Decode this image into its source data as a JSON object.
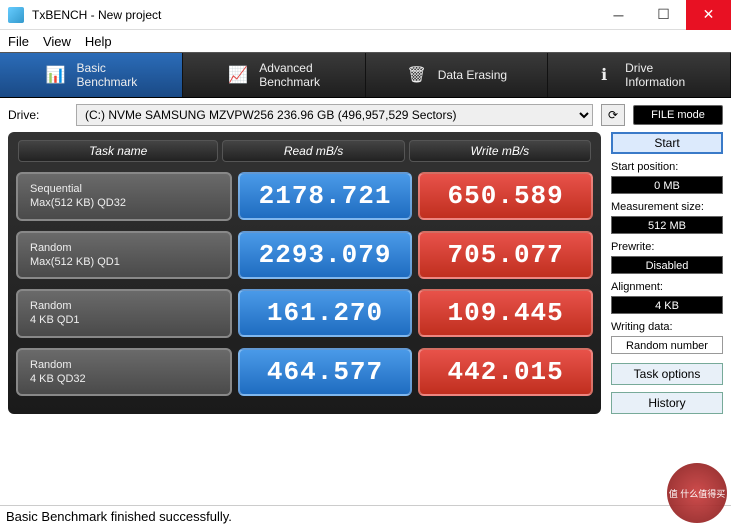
{
  "window": {
    "title": "TxBENCH - New project"
  },
  "menu": [
    "File",
    "View",
    "Help"
  ],
  "tabs": [
    {
      "label": "Basic\nBenchmark",
      "icon": "📊"
    },
    {
      "label": "Advanced\nBenchmark",
      "icon": "📈"
    },
    {
      "label": "Data Erasing",
      "icon": "🗑"
    },
    {
      "label": "Drive\nInformation",
      "icon": "ℹ"
    }
  ],
  "drive": {
    "label": "Drive:",
    "selected": "(C:) NVMe SAMSUNG MZVPW256  236.96 GB (496,957,529 Sectors)",
    "filemode": "FILE mode"
  },
  "headers": {
    "task": "Task name",
    "read": "Read mB/s",
    "write": "Write mB/s"
  },
  "rows": [
    {
      "name1": "Sequential",
      "name2": "Max(512 KB) QD32",
      "read": "2178.721",
      "write": "650.589"
    },
    {
      "name1": "Random",
      "name2": "Max(512 KB) QD1",
      "read": "2293.079",
      "write": "705.077"
    },
    {
      "name1": "Random",
      "name2": "4 KB QD1",
      "read": "161.270",
      "write": "109.445"
    },
    {
      "name1": "Random",
      "name2": "4 KB QD32",
      "read": "464.577",
      "write": "442.015"
    }
  ],
  "side": {
    "start": "Start",
    "startpos_label": "Start position:",
    "startpos": "0 MB",
    "msize_label": "Measurement size:",
    "msize": "512 MB",
    "prewrite_label": "Prewrite:",
    "prewrite": "Disabled",
    "align_label": "Alignment:",
    "align": "4 KB",
    "wdata_label": "Writing data:",
    "wdata": "Random number",
    "taskopt": "Task options",
    "history": "History"
  },
  "status": "Basic Benchmark finished successfully.",
  "watermark": "值 什么值得买"
}
